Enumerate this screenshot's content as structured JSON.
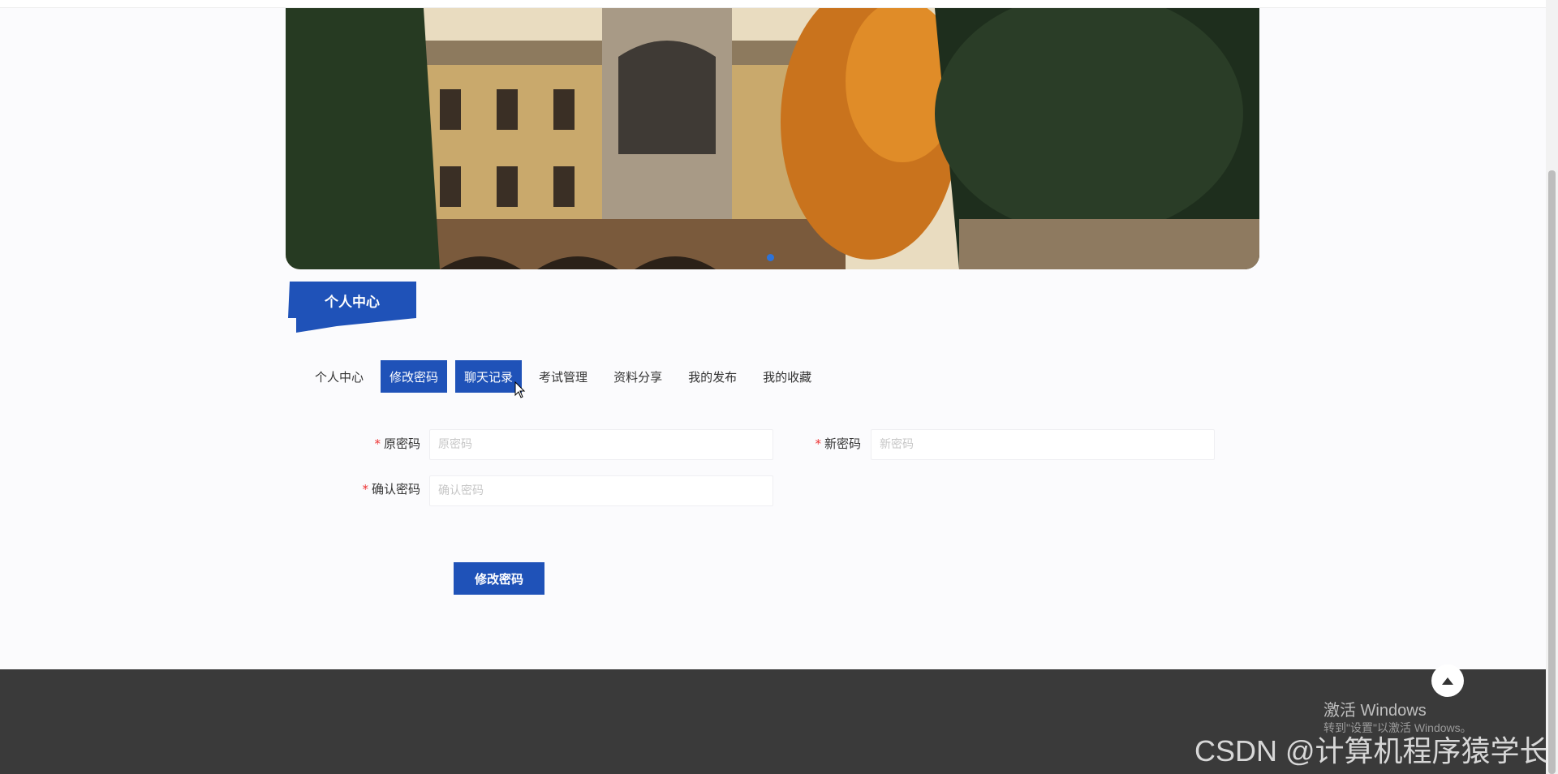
{
  "section_title": "个人中心",
  "tabs": [
    {
      "label": "个人中心",
      "active": false
    },
    {
      "label": "修改密码",
      "active": true
    },
    {
      "label": "聊天记录",
      "active": true
    },
    {
      "label": "考试管理",
      "active": false
    },
    {
      "label": "资料分享",
      "active": false
    },
    {
      "label": "我的发布",
      "active": false
    },
    {
      "label": "我的收藏",
      "active": false
    }
  ],
  "form": {
    "required_mark": "*",
    "old_password": {
      "label": "原密码",
      "placeholder": "原密码",
      "value": ""
    },
    "new_password": {
      "label": "新密码",
      "placeholder": "新密码",
      "value": ""
    },
    "confirm_password": {
      "label": "确认密码",
      "placeholder": "确认密码",
      "value": ""
    },
    "submit_label": "修改密码"
  },
  "overlay": {
    "windows_activate": "激活 Windows",
    "windows_activate_sub": "转到\"设置\"以激活 Windows。",
    "watermark": "CSDN @计算机程序猿学长"
  },
  "colors": {
    "primary": "#1f52b8",
    "footer": "#3a3a3a",
    "required": "#e33333"
  },
  "icons": {
    "back_to_top": "arrow-up-icon",
    "carousel_dot": "carousel-dot-icon"
  }
}
